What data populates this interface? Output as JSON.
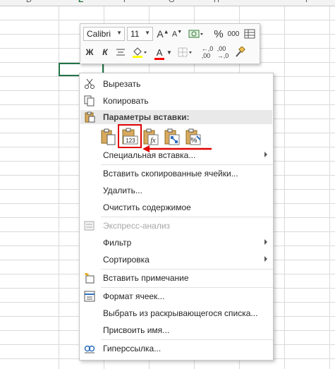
{
  "sheet": {
    "column_headers": [
      "D",
      "E",
      "F",
      "G",
      "H",
      "I"
    ]
  },
  "mini_toolbar": {
    "font_name": "Calibri",
    "font_size": "11",
    "bold_label": "Ж",
    "italic_label": "К",
    "percent_label": "%",
    "thousands_label": "000",
    "font_color_label": "А",
    "highlight_color": "#ffff00",
    "font_color": "#ff0000"
  },
  "context_menu": {
    "cut": "Вырезать",
    "copy": "Копировать",
    "paste_options_header": "Параметры вставки:",
    "paste_special": "Специальная вставка...",
    "insert_copied": "Вставить скопированные ячейки...",
    "delete": "Удалить...",
    "clear": "Очистить содержимое",
    "quick_analysis": "Экспресс-анализ",
    "filter": "Фильтр",
    "sort": "Сортировка",
    "insert_comment": "Вставить примечание",
    "format_cells": "Формат ячеек...",
    "pick_from_list": "Выбрать из раскрывающегося списка...",
    "define_name": "Присвоить имя...",
    "hyperlink": "Гиперссылка...",
    "paste_values_badge": "123",
    "paste_formula_badge": "fx"
  },
  "colors": {
    "highlight_box": "#e00000",
    "active_cell_border": "#217346"
  }
}
